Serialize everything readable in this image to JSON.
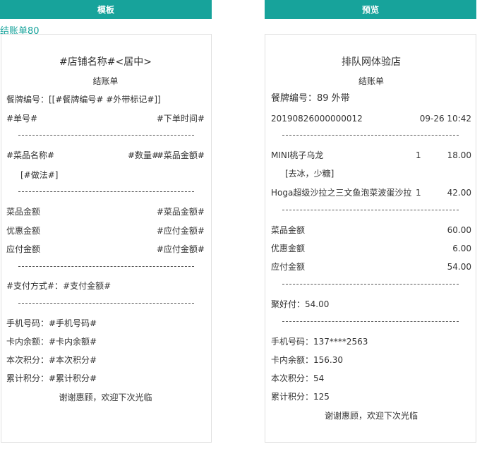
{
  "headers": {
    "template": "模板",
    "preview": "预览"
  },
  "template_name": "结账单80",
  "template": {
    "shop_name": "#店铺名称#<居中>",
    "bill_title": "结账单",
    "meal_no": "餐牌编号：[[#餐牌编号# #外带标记#]]",
    "order_no": "#单号#",
    "order_time": "#下单时间#",
    "dish_name": "#菜品名称#",
    "dish_qty": "#数量#",
    "dish_amount": "#菜品金额#",
    "dish_method": "[#做法#]",
    "summary": [
      {
        "label": "菜品金额",
        "value": "#菜品金额#"
      },
      {
        "label": "优惠金额",
        "value": "#应付金额#"
      },
      {
        "label": "应付金额",
        "value": "#应付金额#"
      }
    ],
    "payment": "#支付方式#：#支付金额#",
    "member": [
      "手机号码：#手机号码#",
      "卡内余额：#卡内余额#",
      "本次积分：#本次积分#",
      "累计积分：#累计积分#"
    ],
    "footer": "谢谢惠顾，欢迎下次光临"
  },
  "preview": {
    "shop_name": "排队网体验店",
    "bill_title": "结账单",
    "meal_no": "餐牌编号：89 外带",
    "order_no": "20190826000000012",
    "order_time": "09-26 10:42",
    "items": [
      {
        "name": "MINI桃子乌龙",
        "qty": "1",
        "amount": "18.00",
        "method": "[去冰，少糖]"
      },
      {
        "name": "Hoga超级沙拉之三文鱼泡菜波蛋沙拉",
        "qty": "1",
        "amount": "42.00"
      }
    ],
    "summary": [
      {
        "label": "菜品金额",
        "value": "60.00"
      },
      {
        "label": "优惠金额",
        "value": "6.00"
      },
      {
        "label": "应付金额",
        "value": "54.00"
      }
    ],
    "payment": "聚好付：54.00",
    "member": [
      "手机号码：137****2563",
      "卡内余额：156.30",
      "本次积分：54",
      "累计积分：125"
    ],
    "footer": "谢谢惠顾，欢迎下次光临"
  }
}
